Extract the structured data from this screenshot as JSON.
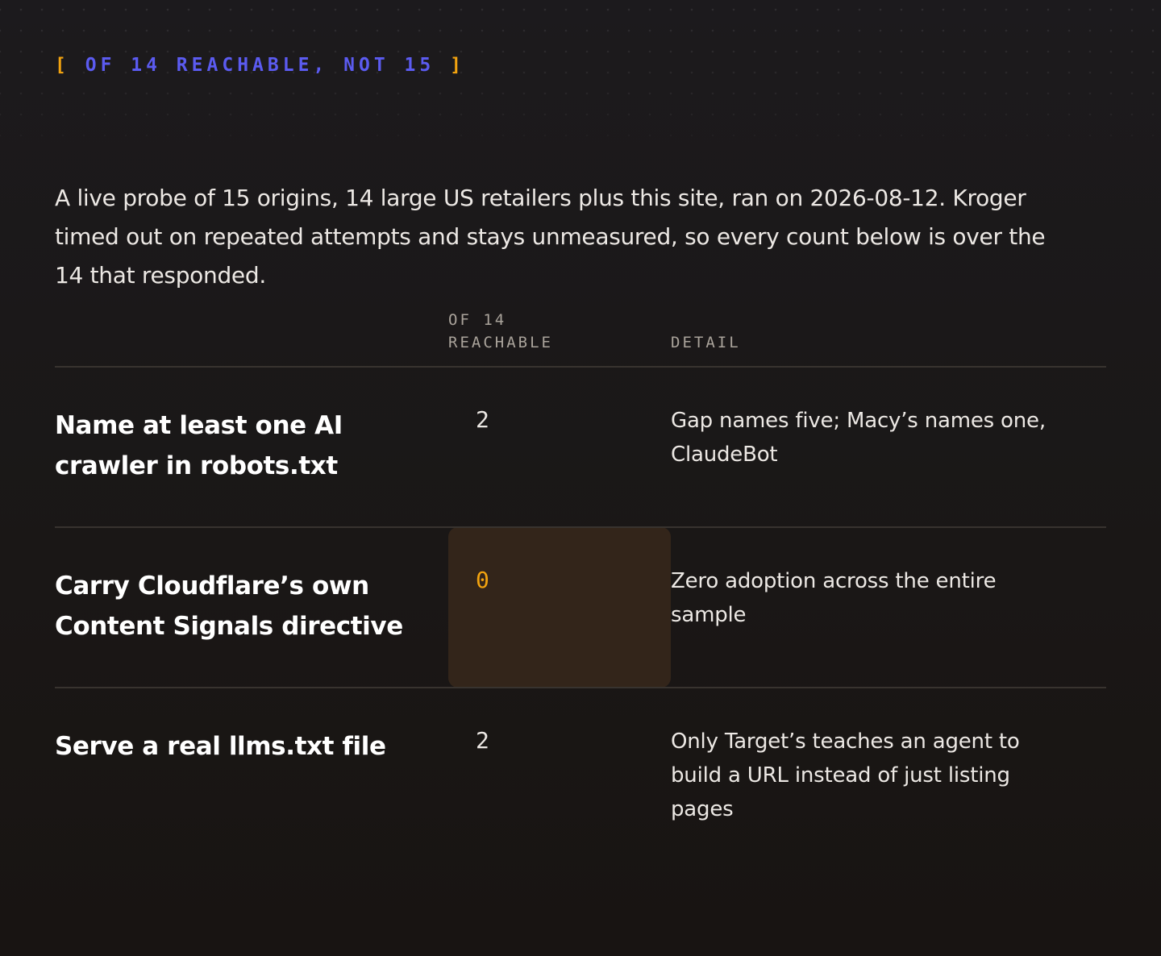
{
  "eyebrow": {
    "open_bracket": "[",
    "text": "OF 14 REACHABLE, NOT 15",
    "close_bracket": "]"
  },
  "intro": "A live probe of 15 origins, 14 large US retailers plus this site, ran on 2026-08-12. Kroger timed out on repeated attempts and stays unmeasured, so every count below is over the 14 that responded.",
  "table": {
    "headers": {
      "label": "",
      "count": "OF 14 REACHABLE",
      "detail": "DETAIL"
    },
    "rows": [
      {
        "label": "Name at least one AI crawler in robots.txt",
        "count": "2",
        "detail": "Gap names five; Macy’s names one, ClaudeBot",
        "highlighted": false
      },
      {
        "label": "Carry Cloudflare’s own Content Signals directive",
        "count": "0",
        "detail": "Zero adoption across the entire sample",
        "highlighted": true
      },
      {
        "label": "Serve a real llms.txt file",
        "count": "2",
        "detail": "Only Target’s teaches an agent to build a URL instead of just listing pages",
        "highlighted": false
      }
    ]
  },
  "colors": {
    "accent_blue": "#5b5bf0",
    "accent_orange": "#f2a30f",
    "highlight_bg": "#33251a",
    "text": "#ece8e4",
    "muted": "#aaa39b",
    "divider": "#38332f"
  }
}
